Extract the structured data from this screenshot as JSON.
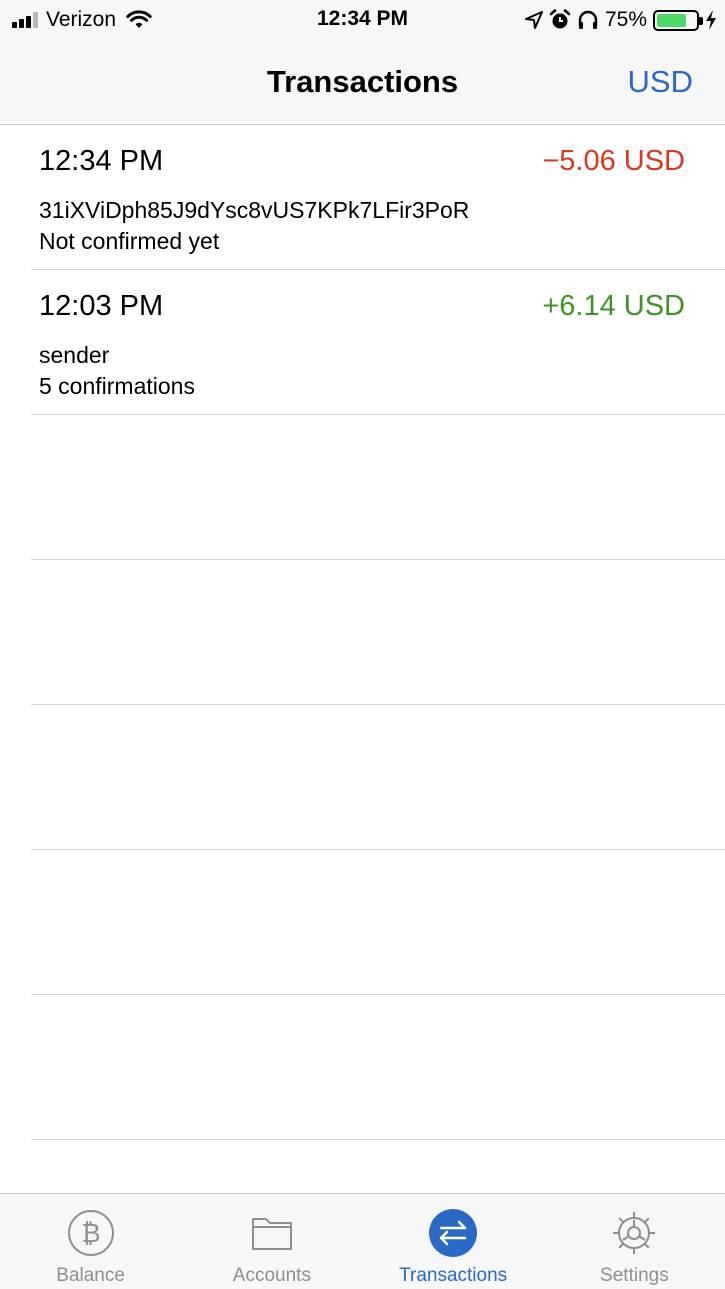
{
  "status_bar": {
    "carrier": "Verizon",
    "time": "12:34 PM",
    "battery_percent": "75%",
    "battery_level": 0.75,
    "signal_bars": 3,
    "icons": [
      "signal-icon",
      "wifi-icon",
      "location-icon",
      "alarm-icon",
      "headphones-icon",
      "battery-icon",
      "charging-icon"
    ]
  },
  "nav": {
    "title": "Transactions",
    "currency_button": "USD"
  },
  "transactions": [
    {
      "time": "12:34 PM",
      "amount": "−5.06 USD",
      "direction": "outgoing",
      "address": "31iXViDph85J9dYsc8vUS7KPk7LFir3PoR",
      "status": "Not confirmed yet"
    },
    {
      "time": "12:03 PM",
      "amount": "+6.14 USD",
      "direction": "incoming",
      "address": "sender",
      "status": "5 confirmations"
    }
  ],
  "tabs": [
    {
      "label": "Balance",
      "icon": "bitcoin-icon",
      "active": false
    },
    {
      "label": "Accounts",
      "icon": "folder-icon",
      "active": false
    },
    {
      "label": "Transactions",
      "icon": "transfer-arrows-icon",
      "active": true
    },
    {
      "label": "Settings",
      "icon": "gear-icon",
      "active": false
    }
  ],
  "colors": {
    "accent": "#2a69c6",
    "negative": "#d9391e",
    "positive": "#3d9426",
    "battery": "#4cd964"
  }
}
